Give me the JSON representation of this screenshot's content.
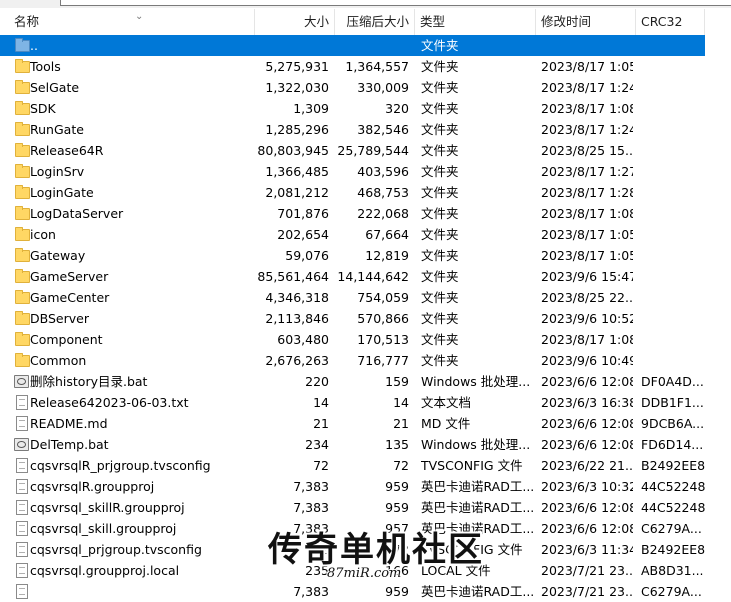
{
  "columns": {
    "name": "名称",
    "size": "大小",
    "packed": "压缩后大小",
    "type": "类型",
    "modified": "修改时间",
    "crc": "CRC32"
  },
  "rows": [
    {
      "icon": "folder-up-icon",
      "name": "..",
      "size": "",
      "packed": "",
      "type": "文件夹",
      "modified": "",
      "crc": "",
      "selected": true
    },
    {
      "icon": "folder-icon",
      "name": "Tools",
      "size": "5,275,931",
      "packed": "1,364,557",
      "type": "文件夹",
      "modified": "2023/8/17 1:05",
      "crc": ""
    },
    {
      "icon": "folder-icon",
      "name": "SelGate",
      "size": "1,322,030",
      "packed": "330,009",
      "type": "文件夹",
      "modified": "2023/8/17 1:24",
      "crc": ""
    },
    {
      "icon": "folder-icon",
      "name": "SDK",
      "size": "1,309",
      "packed": "320",
      "type": "文件夹",
      "modified": "2023/8/17 1:08",
      "crc": ""
    },
    {
      "icon": "folder-icon",
      "name": "RunGate",
      "size": "1,285,296",
      "packed": "382,546",
      "type": "文件夹",
      "modified": "2023/8/17 1:24",
      "crc": ""
    },
    {
      "icon": "folder-icon",
      "name": "Release64R",
      "size": "80,803,945",
      "packed": "25,789,544",
      "type": "文件夹",
      "modified": "2023/8/25 15...",
      "crc": ""
    },
    {
      "icon": "folder-icon",
      "name": "LoginSrv",
      "size": "1,366,485",
      "packed": "403,596",
      "type": "文件夹",
      "modified": "2023/8/17 1:27",
      "crc": ""
    },
    {
      "icon": "folder-icon",
      "name": "LoginGate",
      "size": "2,081,212",
      "packed": "468,753",
      "type": "文件夹",
      "modified": "2023/8/17 1:28",
      "crc": ""
    },
    {
      "icon": "folder-icon",
      "name": "LogDataServer",
      "size": "701,876",
      "packed": "222,068",
      "type": "文件夹",
      "modified": "2023/8/17 1:08",
      "crc": ""
    },
    {
      "icon": "folder-icon",
      "name": "icon",
      "size": "202,654",
      "packed": "67,664",
      "type": "文件夹",
      "modified": "2023/8/17 1:05",
      "crc": ""
    },
    {
      "icon": "folder-icon",
      "name": "Gateway",
      "size": "59,076",
      "packed": "12,819",
      "type": "文件夹",
      "modified": "2023/8/17 1:05",
      "crc": ""
    },
    {
      "icon": "folder-icon",
      "name": "GameServer",
      "size": "85,561,464",
      "packed": "14,144,642",
      "type": "文件夹",
      "modified": "2023/9/6 15:47",
      "crc": ""
    },
    {
      "icon": "folder-icon",
      "name": "GameCenter",
      "size": "4,346,318",
      "packed": "754,059",
      "type": "文件夹",
      "modified": "2023/8/25 22...",
      "crc": ""
    },
    {
      "icon": "folder-icon",
      "name": "DBServer",
      "size": "2,113,846",
      "packed": "570,866",
      "type": "文件夹",
      "modified": "2023/9/6 10:52",
      "crc": ""
    },
    {
      "icon": "folder-icon",
      "name": "Component",
      "size": "603,480",
      "packed": "170,513",
      "type": "文件夹",
      "modified": "2023/8/17 1:08",
      "crc": ""
    },
    {
      "icon": "folder-icon",
      "name": "Common",
      "size": "2,676,263",
      "packed": "716,777",
      "type": "文件夹",
      "modified": "2023/9/6 10:49",
      "crc": ""
    },
    {
      "icon": "batch-file-icon",
      "name": "删除history目录.bat",
      "size": "220",
      "packed": "159",
      "type": "Windows 批处理...",
      "modified": "2023/6/6 12:08",
      "crc": "DF0A4D..."
    },
    {
      "icon": "text-file-icon",
      "name": "Release642023-06-03.txt",
      "size": "14",
      "packed": "14",
      "type": "文本文档",
      "modified": "2023/6/3 16:38",
      "crc": "DDB1F1..."
    },
    {
      "icon": "text-file-icon",
      "name": "README.md",
      "size": "21",
      "packed": "21",
      "type": "MD 文件",
      "modified": "2023/6/6 12:08",
      "crc": "9DCB6A..."
    },
    {
      "icon": "batch-file-icon",
      "name": "DelTemp.bat",
      "size": "234",
      "packed": "135",
      "type": "Windows 批处理...",
      "modified": "2023/6/6 12:08",
      "crc": "FD6D14..."
    },
    {
      "icon": "file-icon",
      "name": "cqsvrsqlR_prjgroup.tvsconfig",
      "size": "72",
      "packed": "72",
      "type": "TVSCONFIG 文件",
      "modified": "2023/6/22 21...",
      "crc": "B2492EE8"
    },
    {
      "icon": "file-icon",
      "name": "cqsvrsqlR.groupproj",
      "size": "7,383",
      "packed": "959",
      "type": "英巴卡迪诺RAD工...",
      "modified": "2023/6/3 10:32",
      "crc": "44C52248"
    },
    {
      "icon": "file-icon",
      "name": "cqsvrsql_skillR.groupproj",
      "size": "7,383",
      "packed": "959",
      "type": "英巴卡迪诺RAD工...",
      "modified": "2023/6/6 12:08",
      "crc": "44C52248"
    },
    {
      "icon": "file-icon",
      "name": "cqsvrsql_skill.groupproj",
      "size": "7,383",
      "packed": "957",
      "type": "英巴卡迪诺RAD工...",
      "modified": "2023/6/6 12:08",
      "crc": "C6279A..."
    },
    {
      "icon": "file-icon",
      "name": "cqsvrsql_prjgroup.tvsconfig",
      "size": "72",
      "packed": "72",
      "type": "TVSCONFIG 文件",
      "modified": "2023/6/3 11:34",
      "crc": "B2492EE8"
    },
    {
      "icon": "file-icon",
      "name": "cqsvrsql.groupproj.local",
      "size": "235",
      "packed": "166",
      "type": "LOCAL 文件",
      "modified": "2023/7/21 23...",
      "crc": "AB8D31..."
    },
    {
      "icon": "file-icon",
      "name": "",
      "size": "7,383",
      "packed": "959",
      "type": "英巴卡迪诺RAD工...",
      "modified": "2023/7/21 23...",
      "crc": "C6279A..."
    }
  ],
  "watermark": {
    "text": "传奇单机社区",
    "url": "87miR.com"
  }
}
